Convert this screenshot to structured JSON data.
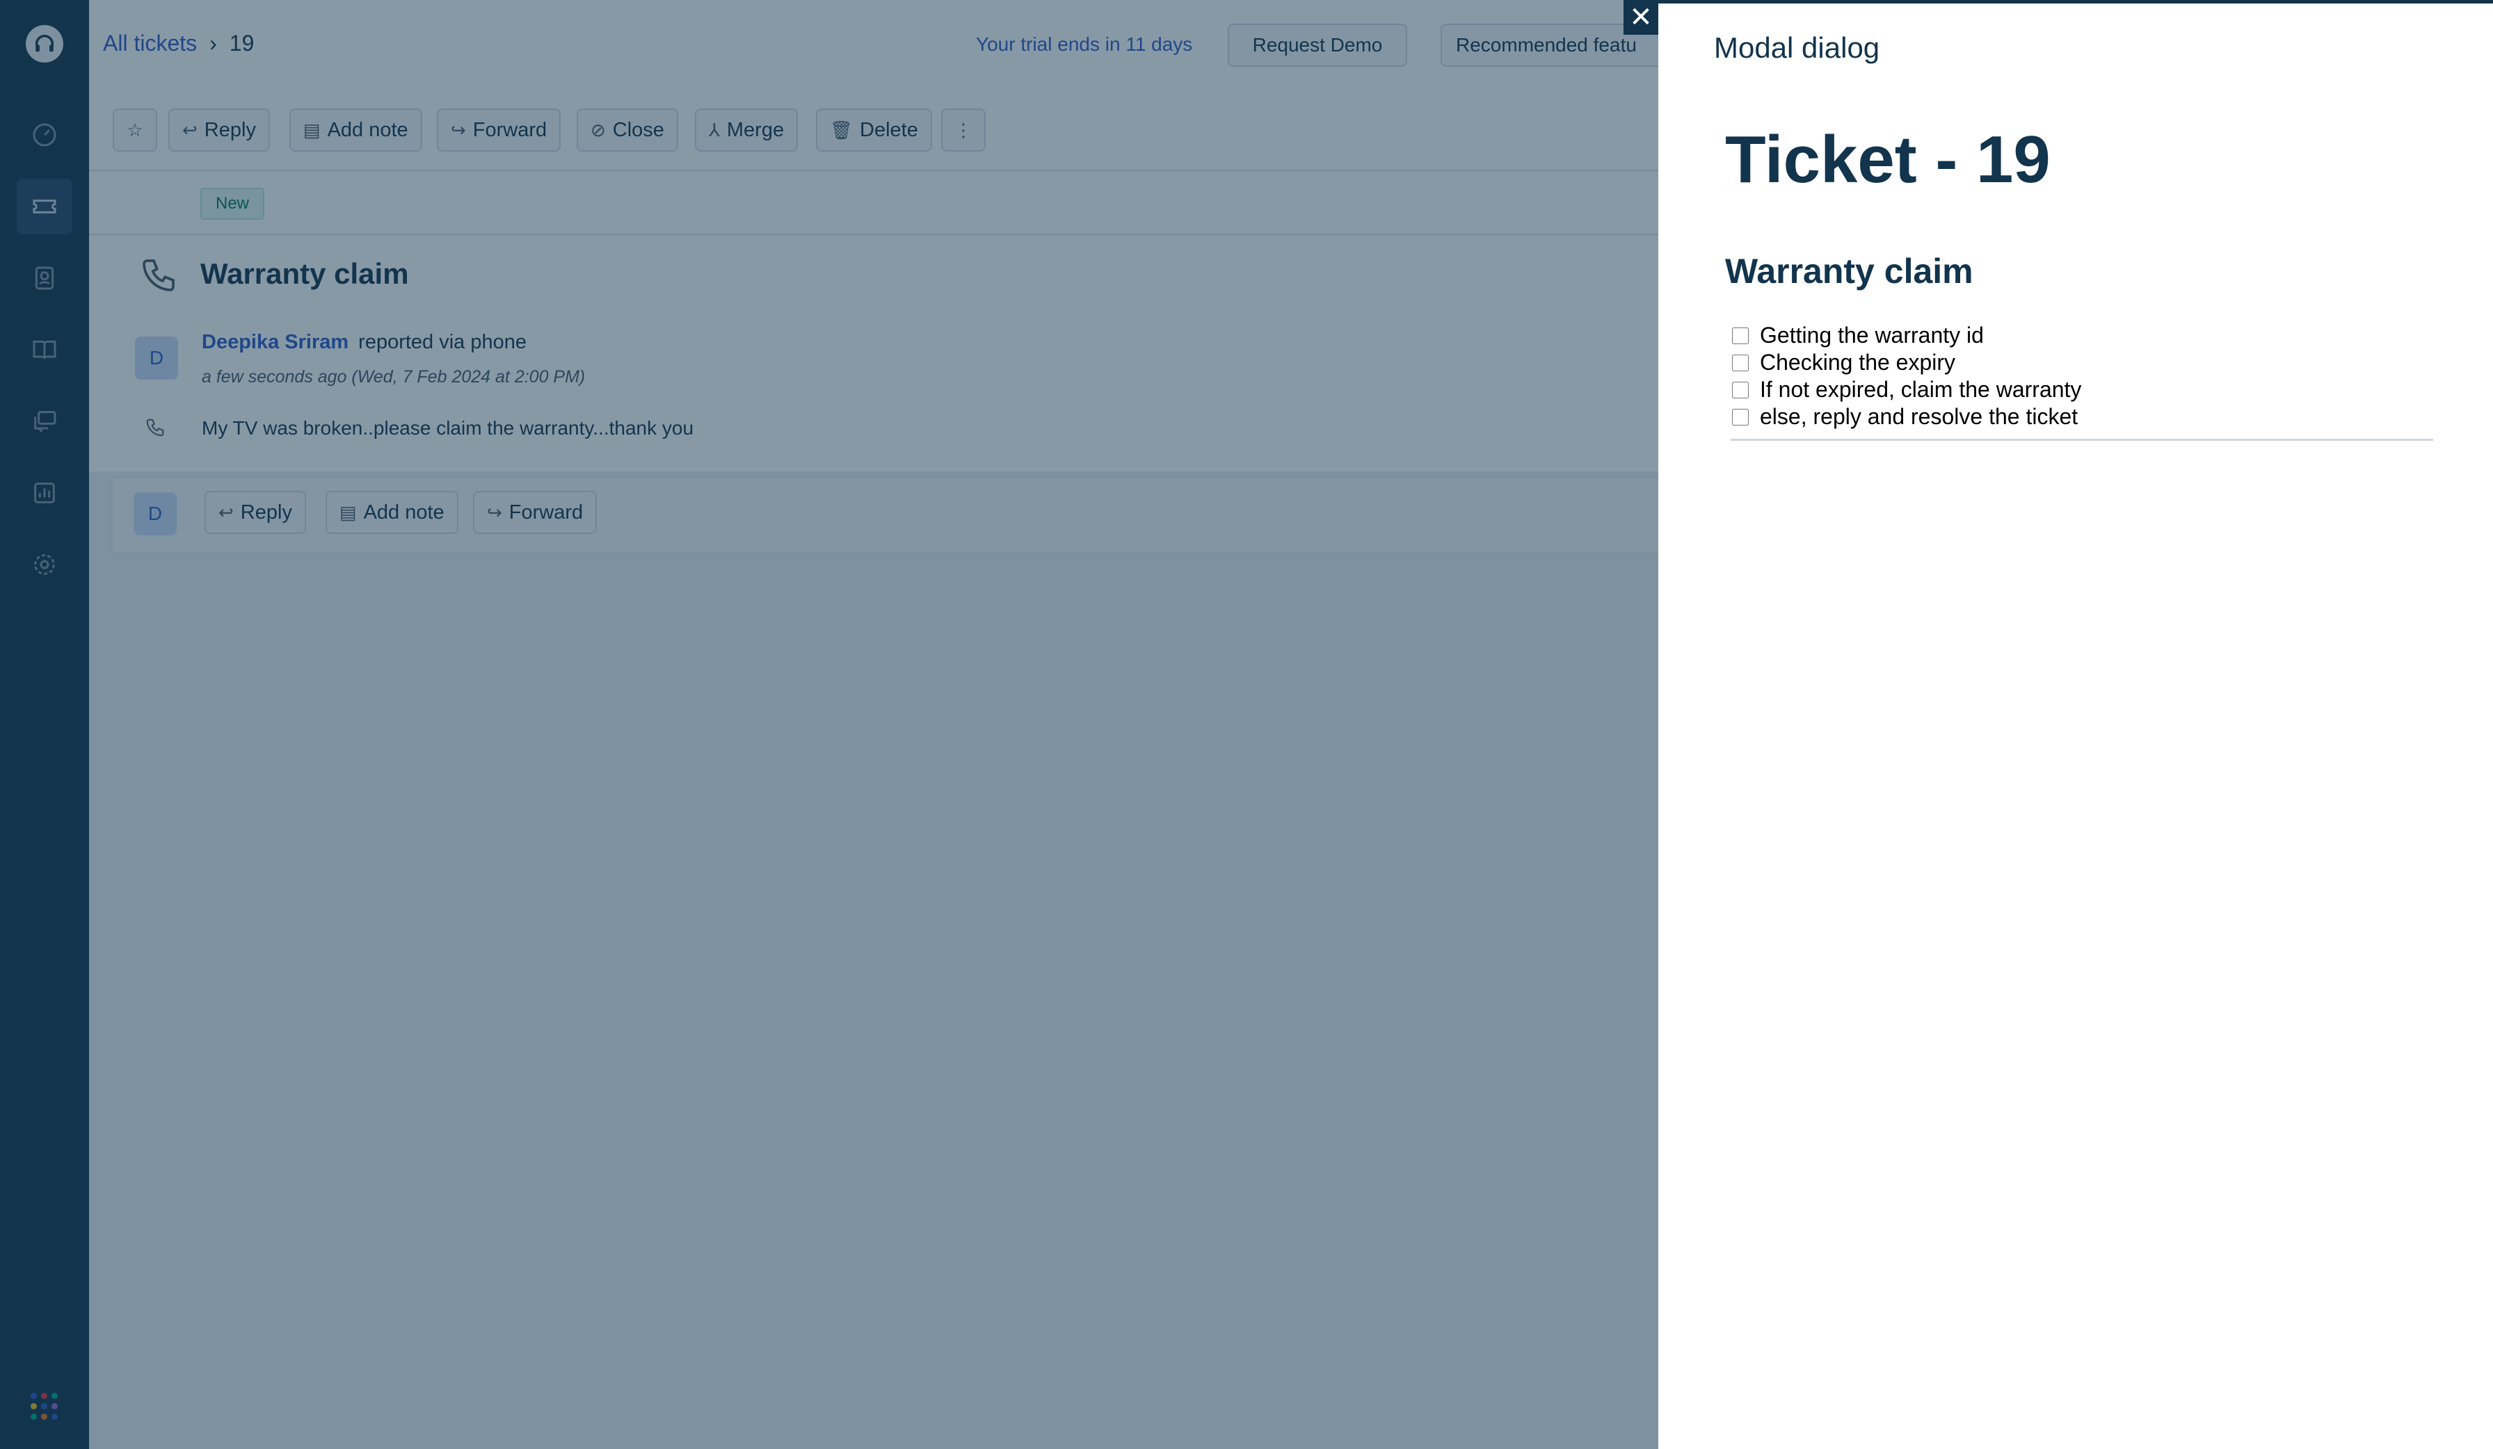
{
  "breadcrumb": {
    "all_tickets": "All tickets",
    "separator": "›",
    "ticket_id": "19"
  },
  "header": {
    "trial_text": "Your trial ends in 11 days",
    "request_demo": "Request Demo",
    "recommended": "Recommended featu"
  },
  "toolbar": {
    "reply": "Reply",
    "add_note": "Add note",
    "forward": "Forward",
    "close": "Close",
    "merge": "Merge",
    "delete": "Delete"
  },
  "ticket": {
    "status": "New",
    "title": "Warranty claim",
    "author": "Deepika Sriram",
    "reported_via": "reported via phone",
    "time": "a few seconds ago (Wed, 7 Feb 2024 at 2:00 PM)",
    "message": "My TV was broken..please claim the warranty...thank you",
    "avatar_initial": "D"
  },
  "reply_bar": {
    "reply": "Reply",
    "add_note": "Add note",
    "forward": "Forward"
  },
  "modal": {
    "heading": "Modal dialog",
    "ticket_title": "Ticket - 19",
    "subtitle": "Warranty claim",
    "checklist": [
      {
        "label": "Getting the warranty id",
        "checked": false
      },
      {
        "label": "Checking the expiry",
        "checked": false
      },
      {
        "label": "If not expired, claim the warranty",
        "checked": false
      },
      {
        "label": "else, reply and resolve the ticket",
        "checked": false
      }
    ]
  },
  "colors": {
    "rail": "#12344d",
    "accent": "#2c5cc5",
    "overlay": "#12344d"
  }
}
